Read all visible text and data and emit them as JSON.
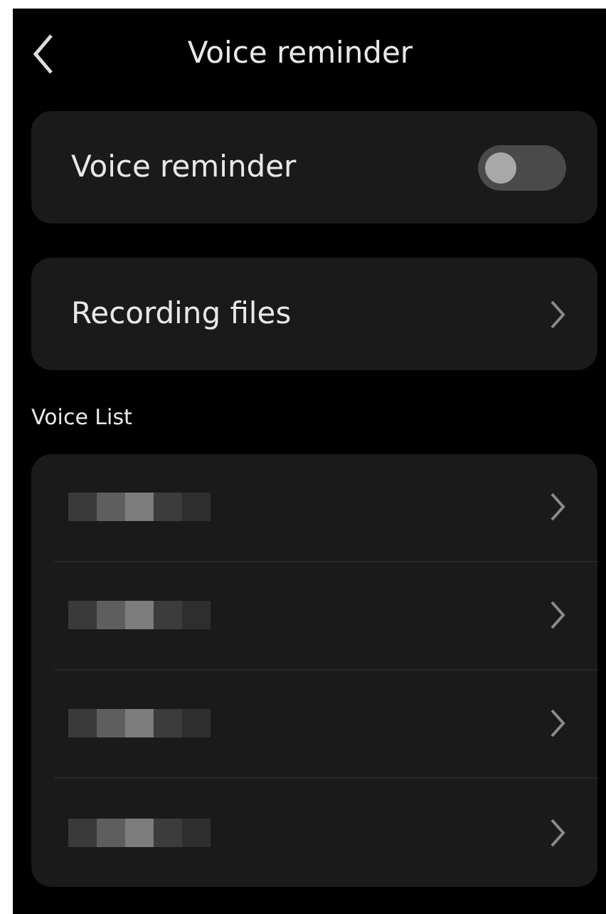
{
  "header": {
    "title": "Voice reminder"
  },
  "voice_reminder": {
    "label": "Voice reminder",
    "on": false
  },
  "recording_files": {
    "label": "Recording files"
  },
  "voice_list": {
    "heading": "Voice List",
    "items": [
      {
        "kind": "redacted"
      },
      {
        "kind": "redacted"
      },
      {
        "kind": "redacted"
      },
      {
        "kind": "redacted"
      }
    ]
  }
}
